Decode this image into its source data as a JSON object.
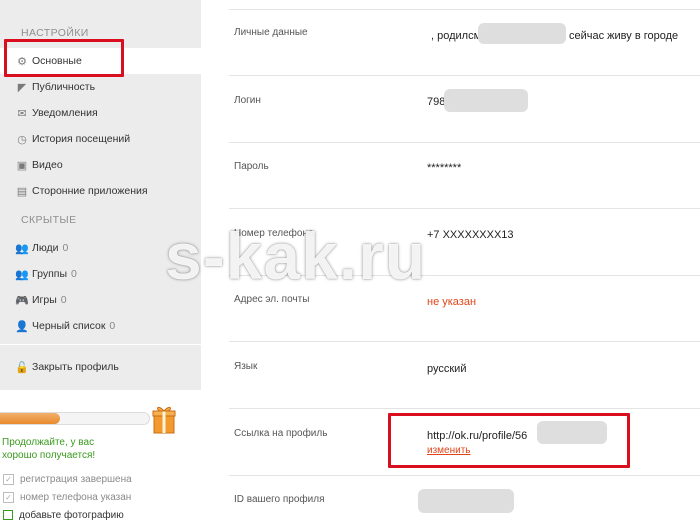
{
  "sidebar": {
    "settings_title": "НАСТРОЙКИ",
    "items": [
      {
        "label": "Основные",
        "icon": "gear-icon"
      },
      {
        "label": "Публичность",
        "icon": "megaphone-icon"
      },
      {
        "label": "Уведомления",
        "icon": "envelope-icon"
      },
      {
        "label": "История посещений",
        "icon": "history-icon"
      },
      {
        "label": "Видео",
        "icon": "video-icon"
      },
      {
        "label": "Сторонние приложения",
        "icon": "apps-icon"
      }
    ],
    "hidden_title": "СКРЫТЫЕ",
    "hidden_items": [
      {
        "label": "Люди",
        "count": "0",
        "icon": "people-icon"
      },
      {
        "label": "Группы",
        "count": "0",
        "icon": "groups-icon"
      },
      {
        "label": "Игры",
        "count": "0",
        "icon": "gamepad-icon"
      },
      {
        "label": "Черный список",
        "count": "0",
        "icon": "blacklist-icon"
      }
    ],
    "close_profile": "Закрыть профиль"
  },
  "progress": {
    "fraction": 0.4,
    "message": "Продолжайте, у вас хорошо получается!",
    "checks": [
      {
        "label": "регистрация завершена",
        "done": true
      },
      {
        "label": "номер телефона указан",
        "done": true
      },
      {
        "label": "добавьте фотографию",
        "done": false
      }
    ]
  },
  "profile": {
    "rows": [
      {
        "label": "Личные данные",
        "value_prefix": ", родилсм",
        "value_suffix": "сейчас живу в городе"
      },
      {
        "label": "Логин",
        "value": "798"
      },
      {
        "label": "Пароль",
        "value": "********"
      },
      {
        "label": "Номер телефона",
        "value": "+7 XXXXXXXX13"
      },
      {
        "label": "Адрес эл. почты",
        "value": "не указан"
      },
      {
        "label": "Язык",
        "value": "русский"
      },
      {
        "label": "Ссылка на профиль",
        "value": "http://ok.ru/profile/56",
        "action": "изменить"
      },
      {
        "label": "ID вашего профиля",
        "value": ""
      }
    ]
  },
  "watermark": "s-kak.ru",
  "colors": {
    "accent": "#e2451b",
    "highlight": "#d90f1f",
    "success": "#3a9a1e"
  }
}
